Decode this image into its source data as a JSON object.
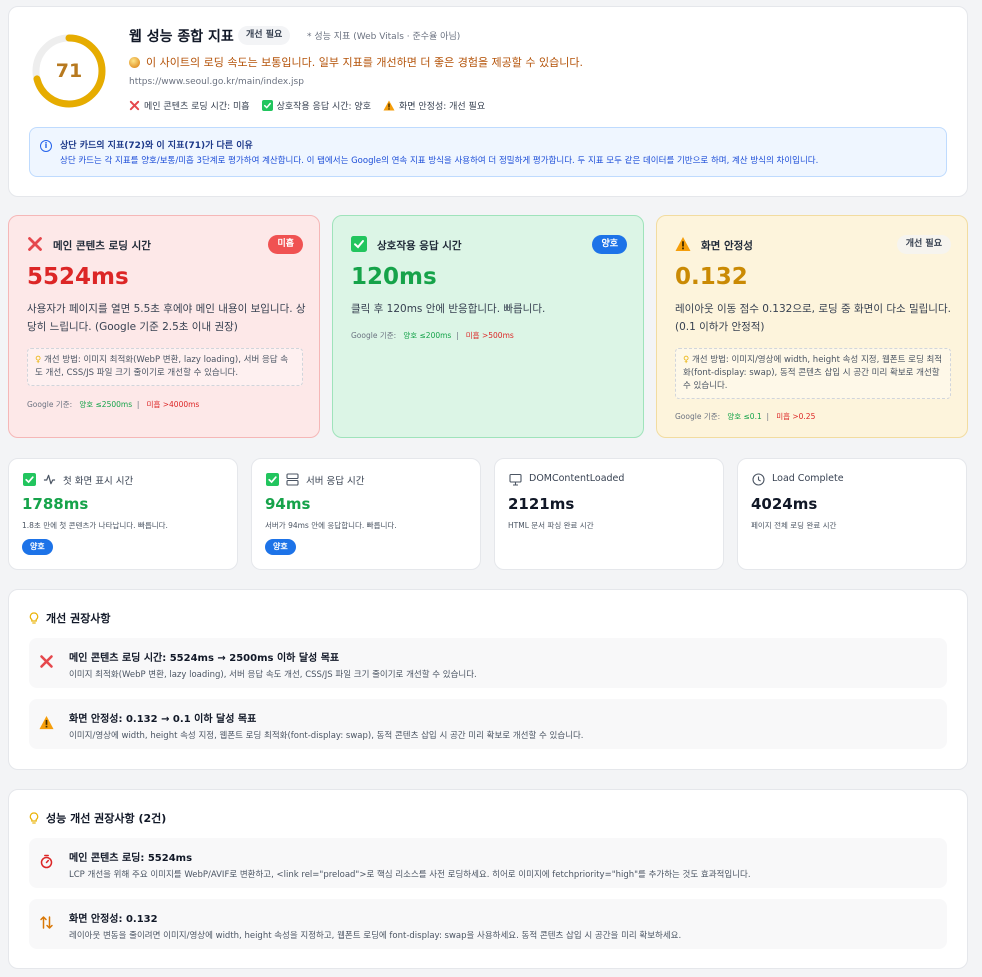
{
  "summary": {
    "score": "71",
    "score_fraction": 0.71,
    "title": "웹 성능 종합 지표",
    "badge": "개선 필요",
    "note": "* 성능 지표 (Web Vitals · 준수율 아님)",
    "description": "이 사이트의 로딩 속도는 보통입니다. 일부 지표를 개선하면 더 좋은 경험을 제공할 수 있습니다.",
    "url": "https://www.seoul.go.kr/main/index.jsp",
    "metrics": [
      {
        "label": "메인 콘텐츠 로딩 시간: 미흡",
        "icon": "x-icon"
      },
      {
        "label": "상호작용 응답 시간: 양호",
        "icon": "check-icon"
      },
      {
        "label": "화면 안정성: 개선 필요",
        "icon": "warning-icon"
      }
    ],
    "info": {
      "title": "상단 카드의 지표(72)와 이 지표(71)가 다른 이유",
      "body": "상단 카드는 각 지표를 양호/보통/미흡 3단계로 평가하여 계산합니다. 이 탭에서는 Google의 연속 지표 방식을 사용하여 더 정밀하게 평가합니다. 두 지표 모두 같은 데이터를 기반으로 하며, 계산 방식의 차이입니다."
    }
  },
  "cards": {
    "lcp": {
      "title": "메인 콘텐츠 로딩 시간",
      "badge": "미흡",
      "value": "5524ms",
      "desc": "사용자가 페이지를 열면 5.5초 후에야 메인 내용이 보입니다. 상당히 느립니다. (Google 기준 2.5초 이내 권장)",
      "tip": "개선 방법: 이미지 최적화(WebP 변환, lazy loading), 서버 응답 속도 개선, CSS/JS 파일 크기 줄이기로 개선할 수 있습니다.",
      "foot_label": "Google 기준:",
      "foot_good": "양호 ≤2500ms",
      "foot_bad": "미흡 >4000ms"
    },
    "inp": {
      "title": "상호작용 응답 시간",
      "badge": "양호",
      "value": "120ms",
      "desc": "클릭 후 120ms 안에 반응합니다. 빠릅니다.",
      "foot_label": "Google 기준:",
      "foot_good": "양호 ≤200ms",
      "foot_bad": "미흡 >500ms"
    },
    "cls": {
      "title": "화면 안정성",
      "badge": "개선 필요",
      "value": "0.132",
      "desc": "레이아웃 이동 점수 0.132으로, 로딩 중 화면이 다소 밀립니다. (0.1 이하가 안정적)",
      "tip": "개선 방법: 이미지/영상에 width, height 속성 지정, 웹폰트 로딩 최적화(font-display: swap), 동적 콘텐츠 삽입 시 공간 미리 확보로 개선할 수 있습니다.",
      "foot_label": "Google 기준:",
      "foot_good": "양호 ≤0.1",
      "foot_bad": "미흡 >0.25"
    }
  },
  "small_cards": [
    {
      "title": "첫 화면 표시 시간",
      "value": "1788ms",
      "desc": "1.8초 만에 첫 콘텐츠가 나타납니다. 빠릅니다.",
      "badge": "양호",
      "color": "#16a34a"
    },
    {
      "title": "서버 응답 시간",
      "value": "94ms",
      "desc": "서버가 94ms 안에 응답합니다. 빠릅니다.",
      "badge": "양호",
      "color": "#16a34a"
    },
    {
      "title": "DOMContentLoaded",
      "value": "2121ms",
      "desc": "HTML 문서 파싱 완료 시간",
      "color": "#111827"
    },
    {
      "title": "Load Complete",
      "value": "4024ms",
      "desc": "페이지 전체 로딩 완료 시간",
      "color": "#111827"
    }
  ],
  "recommendations": {
    "title": "개선 권장사항",
    "items": [
      {
        "title": "메인 콘텐츠 로딩 시간: 5524ms → 2500ms 이하 달성 목표",
        "body": "이미지 최적화(WebP 변환, lazy loading), 서버 응답 속도 개선, CSS/JS 파일 크기 줄이기로 개선할 수 있습니다."
      },
      {
        "title": "화면 안정성: 0.132 → 0.1 이하 달성 목표",
        "body": "이미지/영상에 width, height 속성 지정, 웹폰트 로딩 최적화(font-display: swap), 동적 콘텐츠 삽입 시 공간 미리 확보로 개선할 수 있습니다."
      }
    ]
  },
  "perf_recommendations": {
    "title": "성능 개선 권장사항 (2건)",
    "items": [
      {
        "title": "메인 콘텐츠 로딩: 5524ms",
        "body": "LCP 개선을 위해 주요 이미지를 WebP/AVIF로 변환하고, <link rel=\"preload\">로 핵심 리소스를 사전 로딩하세요. 히어로 이미지에 fetchpriority=\"high\"를 추가하는 것도 효과적입니다."
      },
      {
        "title": "화면 안정성: 0.132",
        "body": "레이아웃 변동을 줄이려면 이미지/영상에 width, height 속성을 지정하고, 웹폰트 로딩에 font-display: swap을 사용하세요. 동적 콘텐츠 삽입 시 공간을 미리 확보하세요."
      }
    ]
  },
  "colors": {
    "score": "#e6ac00",
    "bad": "#dc2626",
    "good": "#16a34a",
    "warn": "#ca8a04",
    "badge_bad": "#f05252",
    "badge_good": "#1d73e8"
  }
}
